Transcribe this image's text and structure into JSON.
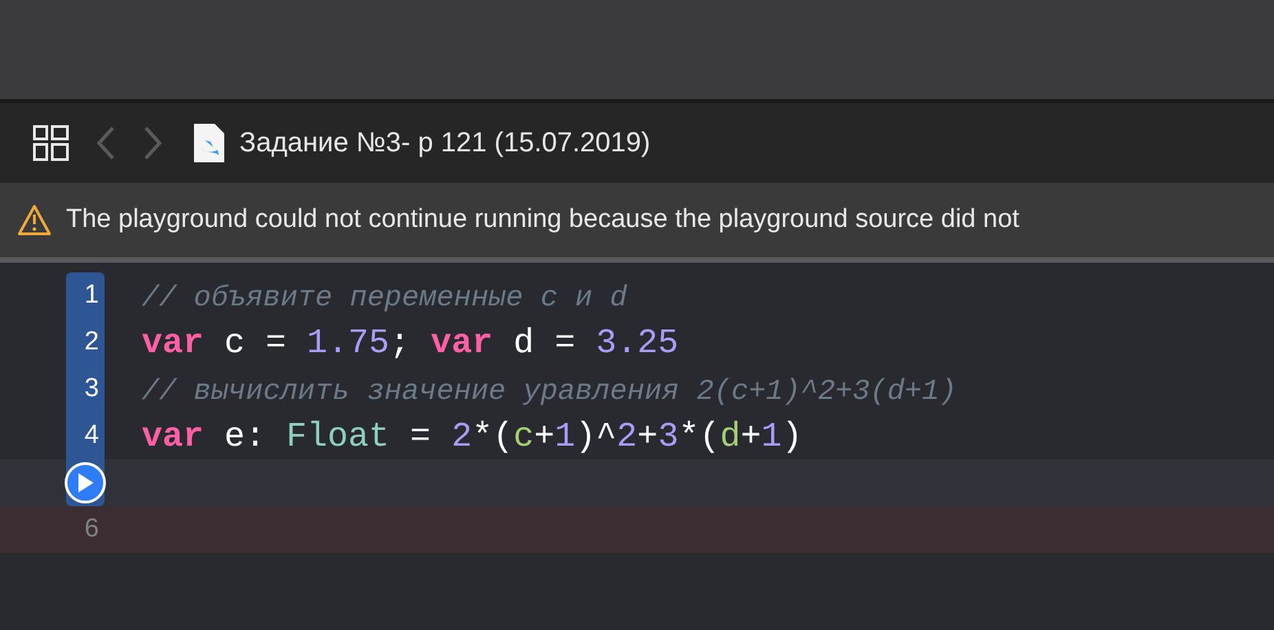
{
  "toolbar": {
    "title": "Задание №3- p 121 (15.07.2019)",
    "back_disabled": true,
    "forward_disabled": true
  },
  "warning": {
    "text": "The playground could not continue running because the playground source did not"
  },
  "lines": [
    {
      "kind": "number",
      "number": "1",
      "selected": true,
      "error": false,
      "tokens": [
        {
          "kind": "comment",
          "text": "// объявите переменные c и d"
        }
      ]
    },
    {
      "kind": "number",
      "number": "2",
      "selected": true,
      "error": false,
      "tokens": [
        {
          "kind": "keyword",
          "text": "var"
        },
        {
          "kind": "plain",
          "text": " c = "
        },
        {
          "kind": "number",
          "text": "1.75"
        },
        {
          "kind": "plain",
          "text": "; "
        },
        {
          "kind": "keyword",
          "text": "var"
        },
        {
          "kind": "plain",
          "text": " d = "
        },
        {
          "kind": "number",
          "text": "3.25"
        }
      ]
    },
    {
      "kind": "number",
      "number": "3",
      "selected": true,
      "error": false,
      "tokens": [
        {
          "kind": "comment",
          "text": "// вычислить значение уравления 2(c+1)^2+3(d+1)"
        }
      ]
    },
    {
      "kind": "number",
      "number": "4",
      "selected": true,
      "error": false,
      "tokens": [
        {
          "kind": "keyword",
          "text": "var"
        },
        {
          "kind": "plain",
          "text": " e: "
        },
        {
          "kind": "type",
          "text": "Float"
        },
        {
          "kind": "plain",
          "text": " = "
        },
        {
          "kind": "number",
          "text": "2"
        },
        {
          "kind": "plain",
          "text": "*("
        },
        {
          "kind": "ident",
          "text": "c"
        },
        {
          "kind": "plain",
          "text": "+"
        },
        {
          "kind": "number",
          "text": "1"
        },
        {
          "kind": "plain",
          "text": ")^"
        },
        {
          "kind": "number",
          "text": "2"
        },
        {
          "kind": "plain",
          "text": "+"
        },
        {
          "kind": "number",
          "text": "3"
        },
        {
          "kind": "plain",
          "text": "*("
        },
        {
          "kind": "ident",
          "text": "d"
        },
        {
          "kind": "plain",
          "text": "+"
        },
        {
          "kind": "number",
          "text": "1"
        },
        {
          "kind": "plain",
          "text": ")"
        }
      ]
    },
    {
      "kind": "run",
      "selected": true,
      "error": false
    },
    {
      "kind": "number",
      "number": "6",
      "selected": false,
      "error": true
    }
  ]
}
